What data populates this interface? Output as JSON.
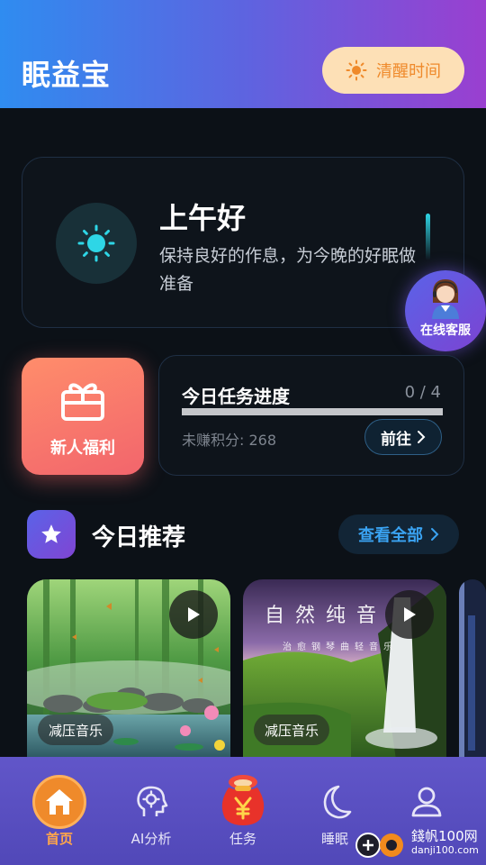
{
  "header": {
    "app_title": "眠益宝",
    "wake_button_label": "清醒时间",
    "gradient": [
      "#2f8cf0",
      "#9a3fd0"
    ]
  },
  "greeting": {
    "title": "上午好",
    "subtitle": "保持良好的作息，为今晚的好眠做准备",
    "icon": "sun-icon",
    "accent": "#2ed6e6"
  },
  "customer_service": {
    "label": "在线客服",
    "icon": "agent-avatar-icon"
  },
  "perk": {
    "label": "新人福利",
    "icon": "gift-icon",
    "gradient": [
      "#ff8d6b",
      "#f2656c"
    ]
  },
  "tasks": {
    "title": "今日任务进度",
    "count_text": "0 / 4",
    "progress": 0,
    "points_text": "未赚积分: 268",
    "go_label": "前往"
  },
  "recommend": {
    "title": "今日推荐",
    "view_all_label": "查看全部",
    "items": [
      {
        "tag": "减压音乐",
        "overlay_title": "",
        "overlay_sub": ""
      },
      {
        "tag": "减压音乐",
        "overlay_title": "自然纯音",
        "overlay_sub": "治愈钢琴曲轻音乐"
      }
    ]
  },
  "nav": {
    "items": [
      {
        "label": "首页",
        "icon": "home-icon",
        "active": true
      },
      {
        "label": "AI分析",
        "icon": "ai-head-icon",
        "active": false
      },
      {
        "label": "任务",
        "icon": "money-bag-icon",
        "active": false
      },
      {
        "label": "睡眠",
        "icon": "moon-icon",
        "active": false
      },
      {
        "label": "",
        "icon": "user-icon",
        "active": false
      }
    ]
  },
  "watermark": {
    "line1": "錢帆100网",
    "line2": "danji100.com"
  }
}
